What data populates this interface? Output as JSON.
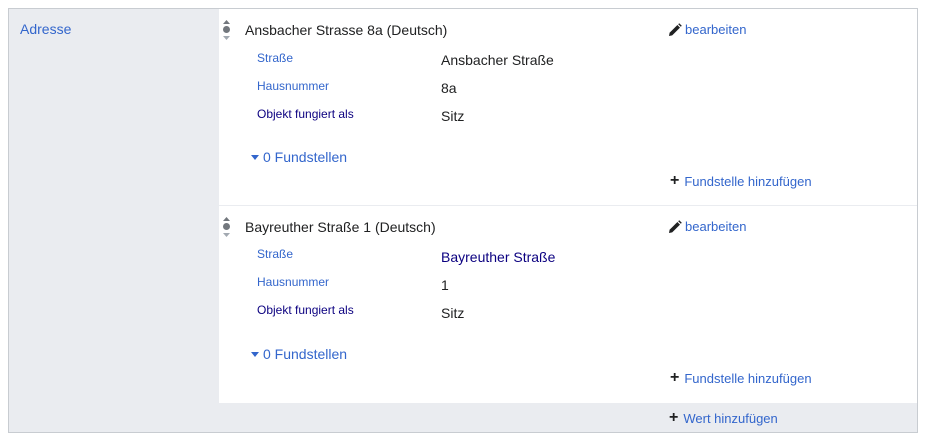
{
  "property": {
    "label": "Adresse"
  },
  "statements": [
    {
      "value": "Ansbacher Strasse 8a (Deutsch)",
      "edit_label": "bearbeiten",
      "qualifiers": [
        {
          "key": "Straße",
          "value": "Ansbacher Straße"
        },
        {
          "key": "Hausnummer",
          "value": "8a"
        },
        {
          "key": "Objekt fungiert als",
          "value": "Sitz"
        }
      ],
      "references_toggle": "0 Fundstellen",
      "add_reference_label": "Fundstelle hinzufügen"
    },
    {
      "value": "Bayreuther Straße 1 (Deutsch)",
      "edit_label": "bearbeiten",
      "qualifiers": [
        {
          "key": "Straße",
          "value": "Bayreuther Straße"
        },
        {
          "key": "Hausnummer",
          "value": "1"
        },
        {
          "key": "Objekt fungiert als",
          "value": "Sitz"
        }
      ],
      "references_toggle": "0 Fundstellen",
      "add_reference_label": "Fundstelle hinzufügen"
    }
  ],
  "add_value_label": "Wert hinzufügen",
  "icons": {
    "rank": "rank-selector-icon",
    "edit": "pencil-icon",
    "add": "plus-icon",
    "toggle": "triangle-down-icon"
  },
  "colors": {
    "link": "#3366cc",
    "visited_link": "#0b0080",
    "group_bg": "#eaecf0",
    "border": "#c8ccd1"
  }
}
